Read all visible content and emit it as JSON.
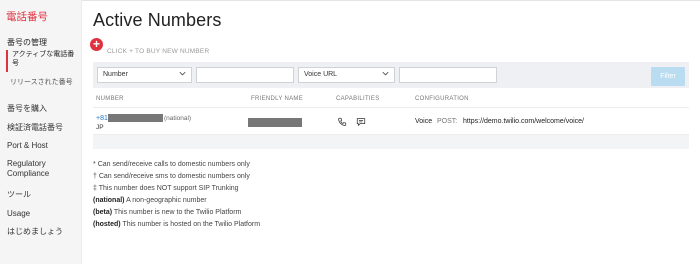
{
  "sidebar": {
    "title": "電話番号",
    "section": "番号の管理",
    "active_sub": "アクティブな電話番号",
    "inactive_sub": "リリースされた番号",
    "items": [
      {
        "label": "番号を購入"
      },
      {
        "label": "検証済電話番号"
      },
      {
        "label": "Port & Host"
      },
      {
        "label": "Regulatory Compliance"
      },
      {
        "label": "ツール"
      },
      {
        "label": "Usage"
      },
      {
        "label": "はじめましょう"
      }
    ]
  },
  "page": {
    "title": "Active Numbers",
    "buy_hint": "CLICK + TO BUY NEW NUMBER",
    "add_symbol": "+"
  },
  "filters": {
    "field_select": "Number",
    "field_value": "",
    "url_select": "Voice URL",
    "url_value": "",
    "button": "Filter"
  },
  "table": {
    "columns": [
      "NUMBER",
      "FRIENDLY NAME",
      "CAPABILITIES",
      "CONFIGURATION"
    ],
    "rows": [
      {
        "number_prefix": "+81",
        "number_tag": "(national)",
        "country": "JP",
        "capabilities": [
          "phone-icon",
          "sms-icon"
        ],
        "config_type": "Voice",
        "config_method": "POST:",
        "config_url": "https://demo.twilio.com/welcome/voice/"
      }
    ]
  },
  "notes": [
    {
      "mark": "*",
      "text": "Can send/receive calls to domestic numbers only"
    },
    {
      "mark": "†",
      "text": "Can send/receive sms to domestic numbers only"
    },
    {
      "mark": "‡",
      "text": "This number does NOT support SIP Trunking"
    },
    {
      "mark": "(national)",
      "text": "A non-geographic number"
    },
    {
      "mark": "(beta)",
      "text": "This number is new to the Twilio Platform"
    },
    {
      "mark": "(hosted)",
      "text": "This number is hosted on the Twilio Platform"
    }
  ],
  "colors": {
    "accent": "#e0313f",
    "link": "#1f7ac8",
    "filter_button": "#b9dcf1"
  }
}
